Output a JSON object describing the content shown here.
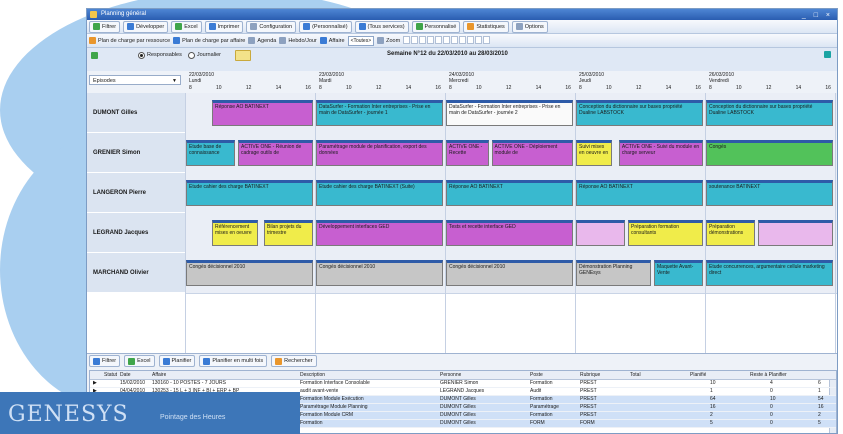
{
  "window": {
    "title": "Planning général",
    "controls": "_ □ ×"
  },
  "toolbar1": [
    {
      "label": "Filtrer",
      "icon": "filter-icon"
    },
    {
      "label": "Développer",
      "icon": "expand-icon"
    },
    {
      "label": "Excel",
      "icon": "excel-icon"
    },
    {
      "label": "Imprimer",
      "icon": "print-icon"
    },
    {
      "label": "Configuration",
      "icon": "gear-icon"
    },
    {
      "label": "(Personnalisé)",
      "icon": "view-icon"
    },
    {
      "label": "(Tous services)",
      "icon": "service-icon"
    },
    {
      "label": "Personnalisé",
      "icon": "person-icon"
    },
    {
      "label": "Statistiques",
      "icon": "stats-icon"
    },
    {
      "label": "Options",
      "icon": "help-icon"
    }
  ],
  "toolbar2": {
    "items": [
      "Plan de charge par ressource",
      "Plan de charge par affaire",
      "Agenda",
      "Hebdo/Jour",
      "Affaire"
    ],
    "affaire_value": "<Toutes>",
    "zoom_label": "Zoom"
  },
  "filter": {
    "option1": "Responsables",
    "option2": "Journalier",
    "week_label": "Semaine N°12 du 22/03/2010 au 28/03/2010"
  },
  "header": {
    "episodes_label": "Episodes"
  },
  "days": [
    {
      "date": "22/03/2010",
      "name": "Lundi"
    },
    {
      "date": "23/03/2010",
      "name": "Mardi"
    },
    {
      "date": "24/03/2010",
      "name": "Mercredi"
    },
    {
      "date": "25/03/2010",
      "name": "Jeudi"
    },
    {
      "date": "26/03/2010",
      "name": "Vendredi"
    }
  ],
  "hours": [
    "8",
    "10",
    "12",
    "14",
    "16"
  ],
  "resources": [
    "DUMONT Gilles",
    "GRENIER Simon",
    "LANGERON Pierre",
    "LEGRAND Jacques",
    "MARCHAND Olivier"
  ],
  "tasks": [
    {
      "row": 0,
      "day": 0,
      "start": 0.2,
      "end": 1,
      "color": "purple",
      "text": "Réponse AO BATINEXT"
    },
    {
      "row": 0,
      "day": 1,
      "start": 0,
      "end": 1,
      "color": "teal",
      "text": "DataSurfer - Formation Inter entreprises - Prise en main de DataSurfer - journée 1"
    },
    {
      "row": 0,
      "day": 2,
      "start": 0,
      "end": 1,
      "color": "white",
      "text": "DataSurfer - Formation Inter entreprises - Prise en main de DataSurfer - journée 2"
    },
    {
      "row": 0,
      "day": 3,
      "start": 0,
      "end": 1,
      "color": "teal",
      "text": "Conception du dictionnaire sur bases propriété Dualine LABSTOCK"
    },
    {
      "row": 0,
      "day": 4,
      "start": 0,
      "end": 1,
      "color": "teal",
      "text": "Conception du dictionnaire sur bases propriété Dualine LABSTOCK"
    },
    {
      "row": 1,
      "day": 0,
      "start": 0,
      "end": 0.4,
      "color": "teal",
      "text": "Etude base de connaissance"
    },
    {
      "row": 1,
      "day": 0,
      "start": 0.4,
      "end": 1,
      "color": "purple",
      "text": "ACTIVE ONE - Réunion de cadrage outils de"
    },
    {
      "row": 1,
      "day": 1,
      "start": 0,
      "end": 1,
      "color": "purple",
      "text": "Paramétrage module de planification, export des données"
    },
    {
      "row": 1,
      "day": 2,
      "start": 0,
      "end": 0.35,
      "color": "purple",
      "text": "ACTIVE ONE - Recette"
    },
    {
      "row": 1,
      "day": 2,
      "start": 0.35,
      "end": 1,
      "color": "purple",
      "text": "ACTIVE ONE - Déploiement module de"
    },
    {
      "row": 1,
      "day": 3,
      "start": 0,
      "end": 0.3,
      "color": "yellow",
      "text": "Suivi mises en oeuvre en"
    },
    {
      "row": 1,
      "day": 3,
      "start": 0.33,
      "end": 1,
      "color": "purple",
      "text": "ACTIVE ONE - Suivi du module en charge serveur"
    },
    {
      "row": 1,
      "day": 4,
      "start": 0,
      "end": 1,
      "color": "green",
      "text": "Congés"
    },
    {
      "row": 2,
      "day": 0,
      "start": 0,
      "end": 1,
      "color": "teal",
      "text": "Etude cahier des charge BATINEXT"
    },
    {
      "row": 2,
      "day": 1,
      "start": 0,
      "end": 1,
      "color": "teal",
      "text": "Etude cahier des charge BATINEXT (Suite)"
    },
    {
      "row": 2,
      "day": 2,
      "start": 0,
      "end": 1,
      "color": "teal",
      "text": "Réponse AO BATINEXT"
    },
    {
      "row": 2,
      "day": 3,
      "start": 0,
      "end": 1,
      "color": "teal",
      "text": "Réponse AO BATINEXT"
    },
    {
      "row": 2,
      "day": 4,
      "start": 0,
      "end": 1,
      "color": "teal",
      "text": "soutenance BATINEXT"
    },
    {
      "row": 3,
      "day": 0,
      "start": 0.2,
      "end": 0.58,
      "color": "yellow",
      "text": "Référencement mises en oeuvre"
    },
    {
      "row": 3,
      "day": 0,
      "start": 0.6,
      "end": 1,
      "color": "yellow",
      "text": "Bilan projets du trimestre"
    },
    {
      "row": 3,
      "day": 1,
      "start": 0,
      "end": 1,
      "color": "purple",
      "text": "Développement interfaces GED"
    },
    {
      "row": 3,
      "day": 2,
      "start": 0,
      "end": 1,
      "color": "purple",
      "text": "Tests et recette interface GED"
    },
    {
      "row": 3,
      "day": 3,
      "start": 0,
      "end": 0.4,
      "color": "pink",
      "text": ""
    },
    {
      "row": 3,
      "day": 3,
      "start": 0.4,
      "end": 1,
      "color": "yellow",
      "text": "Préparation formation consultants"
    },
    {
      "row": 3,
      "day": 4,
      "start": 0,
      "end": 0.4,
      "color": "yellow",
      "text": "Préparation démonstrations"
    },
    {
      "row": 3,
      "day": 4,
      "start": 0.4,
      "end": 1,
      "color": "pink",
      "text": ""
    },
    {
      "row": 4,
      "day": 0,
      "start": 0,
      "end": 1,
      "color": "gray",
      "text": "Congés décisionnel 2010"
    },
    {
      "row": 4,
      "day": 1,
      "start": 0,
      "end": 1,
      "color": "gray",
      "text": "Congés décisionnel 2010"
    },
    {
      "row": 4,
      "day": 2,
      "start": 0,
      "end": 1,
      "color": "gray",
      "text": "Congés décisionnel 2010"
    },
    {
      "row": 4,
      "day": 3,
      "start": 0,
      "end": 0.6,
      "color": "gray",
      "text": "Démonstration Planning GENEsys"
    },
    {
      "row": 4,
      "day": 3,
      "start": 0.6,
      "end": 1,
      "color": "teal",
      "text": "Maquette Avant-Vente"
    },
    {
      "row": 4,
      "day": 4,
      "start": 0,
      "end": 1,
      "color": "teal",
      "text": "Etude concurrences, argumentaire cellule marketing direct"
    }
  ],
  "bottom_toolbar": [
    "Filtrer",
    "Excel",
    "Planifier",
    "Planifier en multi fois",
    "Rechercher"
  ],
  "table": {
    "columns": [
      "Statut",
      "Date",
      "Affaire",
      "Description",
      "Personne",
      "Poste",
      "Rubrique",
      "Total",
      "Planifié",
      "Reste à Planifier"
    ],
    "rows": [
      [
        "",
        "15/02/2010",
        "130160 - 10 POSTES - 7 JOURS",
        "Formation Interface Consolable",
        "GRENIER Simon",
        "Formation",
        "PREST",
        "",
        "10",
        "4",
        "6"
      ],
      [
        "",
        "04/04/2010",
        "130253 - 15 L + 3 INF + BI + ERP + BP",
        "audit avant-vente",
        "LEGRAND Jacques",
        "Audit",
        "PREST",
        "",
        "1",
        "0",
        "1"
      ],
      [
        "",
        "",
        "",
        "Formation Module Exécution",
        "DUMONT Gilles",
        "Formation",
        "PREST",
        "",
        "64",
        "10",
        "54"
      ],
      [
        "",
        "",
        "",
        "Paramétrage Module Planning",
        "DUMONT Gilles",
        "Paramétrage",
        "PREST",
        "",
        "16",
        "0",
        "16"
      ],
      [
        "",
        "",
        "",
        "Formation Module CRM",
        "DUMONT Gilles",
        "Formation",
        "PREST",
        "",
        "2",
        "0",
        "2"
      ],
      [
        "",
        "",
        "",
        "Formation",
        "DUMONT Gilles",
        "FORM",
        "FORM",
        "",
        "5",
        "0",
        "5"
      ]
    ]
  },
  "logo": {
    "brand": "GENESYS",
    "tagline": "Pointage des Heures"
  },
  "colors": {
    "purple": "#c75fd0",
    "teal": "#39b9cf",
    "green": "#52c25a",
    "yellow": "#f0ec4a",
    "gray": "#c6c6c6",
    "pink": "#e9b8ec",
    "white": "#fafafa"
  }
}
